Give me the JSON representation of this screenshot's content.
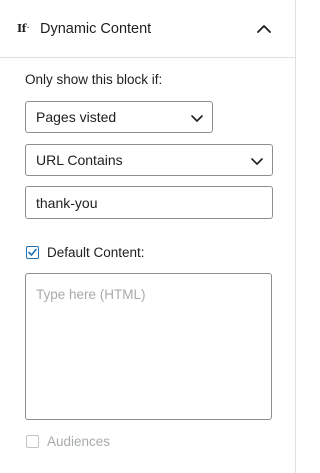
{
  "panel": {
    "icon_glyph": "If",
    "icon_sup": "·",
    "title": "Dynamic Content",
    "icon_name": "chevron-up-icon"
  },
  "condition": {
    "label": "Only show this block if:",
    "rule_type": "Pages visted",
    "match_type": "URL Contains",
    "value": "thank-you"
  },
  "default_content": {
    "label": "Default Content:",
    "checked": true,
    "placeholder": "Type here (HTML)"
  },
  "audiences": {
    "label": "Audiences",
    "checked": false
  },
  "colors": {
    "accent": "#2271b1",
    "border": "#8c8f94",
    "muted_text": "#a7aaad"
  }
}
